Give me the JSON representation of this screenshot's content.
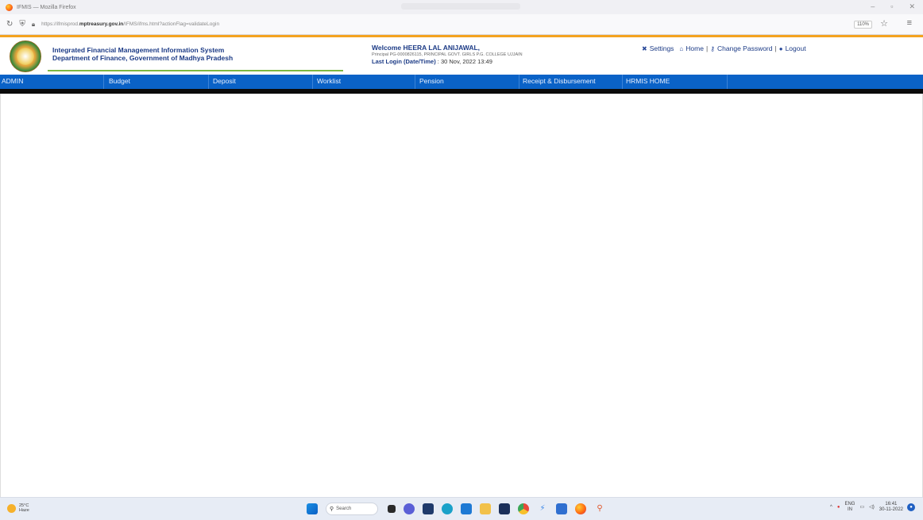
{
  "browser": {
    "window_title": "IFMIS — Mozilla Firefox",
    "url_prefix": "https://ifmisprod.",
    "url_domain": "mptreasury.gov.in",
    "url_path": "/IFMS/ifms.html?actionFlag=validateLogin",
    "zoom": "110%"
  },
  "header": {
    "org_title": "Integrated Financial Management Information System",
    "org_subtitle": "Department of Finance, Government of Madhya Pradesh",
    "welcome": "Welcome HEERA LAL ANIJAWAL,",
    "designation": "Principal PG-0000826115, PRINCIPAL GOVT. GIRLS P.G. COLLEGE UJJAIN",
    "last_login_label": "Last Login (Date/Time)",
    "last_login_value": ": 30 Nov, 2022 13:49",
    "links": {
      "settings": "Settings",
      "home": "Home",
      "change_password": "Change Password",
      "logout": "Logout",
      "separator": "|"
    }
  },
  "menu": {
    "items": [
      {
        "label": "ADMIN"
      },
      {
        "label": "Budget"
      },
      {
        "label": "Deposit"
      },
      {
        "label": "Worklist"
      },
      {
        "label": "Pension"
      },
      {
        "label": "Receipt & Disbursement"
      },
      {
        "label": "HRMIS HOME"
      }
    ]
  },
  "taskbar": {
    "temperature": "25°C",
    "weather": "Haze",
    "search_placeholder": "Search",
    "lang_top": "ENG",
    "lang_bottom": "IN",
    "time": "16:41",
    "date": "30-11-2022"
  },
  "colors": {
    "menubar": "#0a62c7",
    "header_accent": "#f4a320",
    "header_green": "#7db843",
    "brand_blue": "#1c3b86"
  }
}
